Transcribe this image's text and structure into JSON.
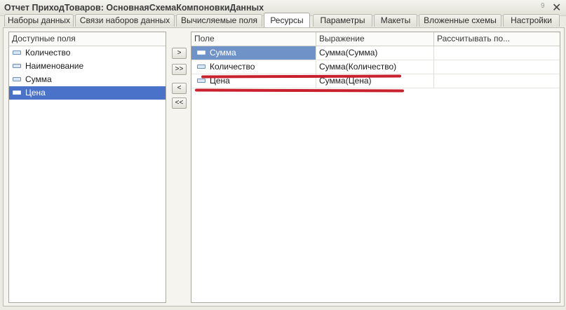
{
  "window": {
    "title": "Отчет ПриходТоваров: ОсновнаяСхемаКомпоновкиДанных",
    "title_number": "9",
    "close_label": "✕"
  },
  "tabs": [
    {
      "label": "Наборы данных"
    },
    {
      "label": "Связи наборов данных"
    },
    {
      "label": "Вычисляемые поля"
    },
    {
      "label": "Ресурсы"
    },
    {
      "label": "Параметры"
    },
    {
      "label": "Макеты"
    },
    {
      "label": "Вложенные схемы"
    },
    {
      "label": "Настройки"
    }
  ],
  "active_tab": "Ресурсы",
  "available_fields": {
    "header": "Доступные поля",
    "items": [
      {
        "label": "Количество"
      },
      {
        "label": "Наименование"
      },
      {
        "label": "Сумма"
      },
      {
        "label": "Цена",
        "selected": true
      }
    ]
  },
  "transfer_buttons": {
    "add": ">",
    "add_all": ">>",
    "remove": "<",
    "remove_all": "<<"
  },
  "resources_table": {
    "columns": [
      "Поле",
      "Выражение",
      "Рассчитывать по..."
    ],
    "rows": [
      {
        "field": "Сумма",
        "expression": "Сумма(Сумма)",
        "calc_by": "",
        "selected": true
      },
      {
        "field": "Количество",
        "expression": "Сумма(Количество)",
        "calc_by": ""
      },
      {
        "field": "Цена",
        "expression": "Сумма(Цена)",
        "calc_by": ""
      }
    ]
  },
  "colors": {
    "selection": "#4a72c9",
    "annotation_underline": "#c8202d",
    "background": "#ecebe3"
  }
}
